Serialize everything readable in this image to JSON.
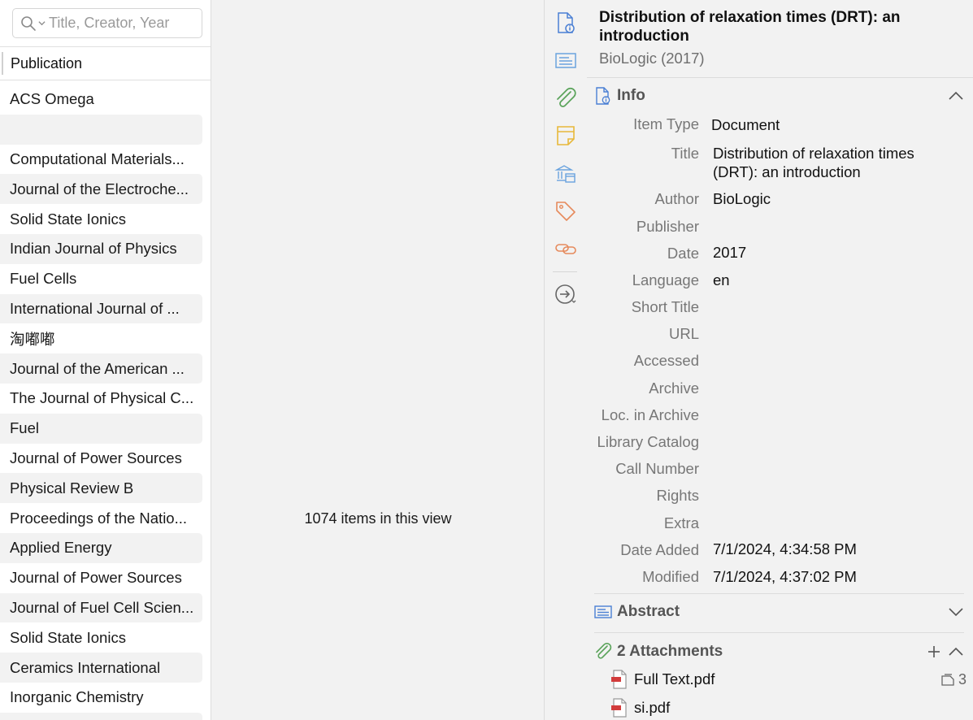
{
  "search": {
    "placeholder": "Title, Creator, Year",
    "value": ""
  },
  "list": {
    "column_header": "Publication",
    "rows": [
      "ACS Omega",
      "",
      "Computational Materials...",
      "Journal of the Electroche...",
      "Solid State Ionics",
      "Indian Journal of Physics",
      "Fuel Cells",
      "International Journal of ...",
      "淘嘟嘟",
      "Journal of the American ...",
      "The Journal of Physical C...",
      "Fuel",
      "Journal of Power Sources",
      "Physical Review B",
      "Proceedings of the Natio...",
      "Applied Energy",
      "Journal of Power Sources",
      "Journal of Fuel Cell Scien...",
      "Solid State Ionics",
      "Ceramics International",
      "Inorganic Chemistry",
      ""
    ]
  },
  "middle": {
    "count_text": "1074 items in this view"
  },
  "sidenav": {
    "icons": [
      "info-icon",
      "abstract-icon",
      "attachments-icon",
      "notes-icon",
      "libraries-collections-icon",
      "tags-icon",
      "related-icon",
      "locate-icon"
    ]
  },
  "item": {
    "title": "Distribution of relaxation times (DRT): an introduction",
    "subtitle": "BioLogic (2017)"
  },
  "info": {
    "heading": "Info",
    "fields": [
      {
        "label": "Item Type",
        "value": "Document"
      },
      {
        "label": "Title",
        "value": "Distribution of relaxation times (DRT): an introduction"
      },
      {
        "label": "Author",
        "value": "BioLogic"
      },
      {
        "label": "Publisher",
        "value": ""
      },
      {
        "label": "Date",
        "value": "2017"
      },
      {
        "label": "Language",
        "value": "en"
      },
      {
        "label": "Short Title",
        "value": ""
      },
      {
        "label": "URL",
        "value": ""
      },
      {
        "label": "Accessed",
        "value": ""
      },
      {
        "label": "Archive",
        "value": ""
      },
      {
        "label": "Loc. in Archive",
        "value": ""
      },
      {
        "label": "Library Catalog",
        "value": ""
      },
      {
        "label": "Call Number",
        "value": ""
      },
      {
        "label": "Rights",
        "value": ""
      },
      {
        "label": "Extra",
        "value": ""
      },
      {
        "label": "Date Added",
        "value": "7/1/2024, 4:34:58 PM"
      },
      {
        "label": "Modified",
        "value": "7/1/2024, 4:37:02 PM"
      }
    ]
  },
  "abstract": {
    "heading": "Abstract"
  },
  "attachments": {
    "heading": "2 Attachments",
    "items": [
      {
        "name": "Full Text.pdf",
        "notes": "3"
      },
      {
        "name": "si.pdf"
      }
    ]
  },
  "colors": {
    "accent_blue": "#4a7fd4",
    "attach_green": "#5aa35a",
    "notes_yellow": "#e8b83a",
    "tags_orange": "#e68a5c",
    "pdf_red": "#d23c3c"
  }
}
